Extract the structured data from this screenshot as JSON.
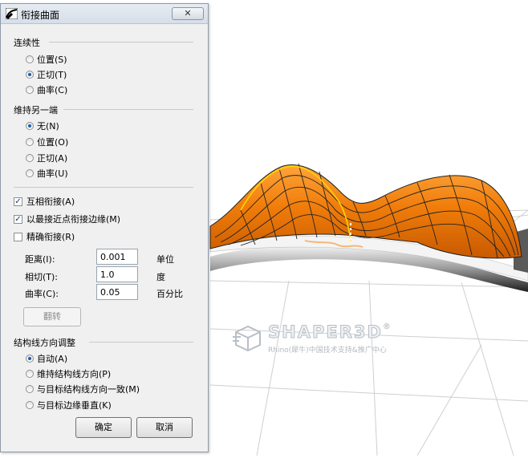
{
  "dialog": {
    "title": "衔接曲面",
    "close_label": "✕"
  },
  "continuity": {
    "label": "连续性",
    "options": [
      {
        "label": "位置(S)",
        "selected": false
      },
      {
        "label": "正切(T)",
        "selected": true
      },
      {
        "label": "曲率(C)",
        "selected": false
      }
    ]
  },
  "maintain_other_end": {
    "label": "维持另一端",
    "options": [
      {
        "label": "无(N)",
        "selected": true
      },
      {
        "label": "位置(O)",
        "selected": false
      },
      {
        "label": "正切(A)",
        "selected": false
      },
      {
        "label": "曲率(U)",
        "selected": false
      }
    ]
  },
  "checks": [
    {
      "label": "互相衔接(A)",
      "checked": true
    },
    {
      "label": "以最接近点衔接边缘(M)",
      "checked": true
    },
    {
      "label": "精确衔接(R)",
      "checked": false
    }
  ],
  "tolerances": [
    {
      "label": "距离(I):",
      "value": "0.001",
      "unit": "单位"
    },
    {
      "label": "相切(T):",
      "value": "1.0",
      "unit": "度"
    },
    {
      "label": "曲率(C):",
      "value": "0.05",
      "unit": "百分比"
    }
  ],
  "flip_label": "翻转",
  "isocurve": {
    "label": "结构线方向调整",
    "options": [
      {
        "label": "自动(A)",
        "selected": true
      },
      {
        "label": "维持结构线方向(P)",
        "selected": false
      },
      {
        "label": "与目标结构线方向一致(M)",
        "selected": false
      },
      {
        "label": "与目标边缘垂直(K)",
        "selected": false
      }
    ]
  },
  "ok_label": "确定",
  "cancel_label": "取消",
  "watermark": {
    "brand": "SHAPER3D",
    "reg": "®",
    "tagline": "Rhino(犀牛)中国技术支持&推广中心"
  },
  "colors": {
    "surface_orange": "#f07d0a",
    "surface_dark": "#c85a00",
    "isocurve_highlight": "#ffd400",
    "accent_blue": "#1d5ea8"
  }
}
